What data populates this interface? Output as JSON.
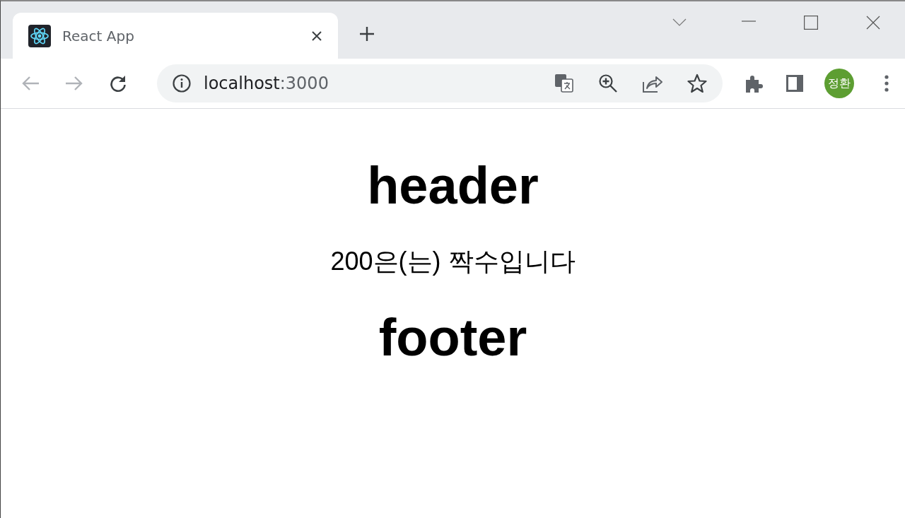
{
  "tab": {
    "title": "React App",
    "selected": true
  },
  "address_bar": {
    "host": "localhost",
    "port": ":3000"
  },
  "profile": {
    "initials": "정환"
  },
  "page": {
    "header": "header",
    "message": "200은(는) 짝수입니다",
    "footer": "footer"
  }
}
